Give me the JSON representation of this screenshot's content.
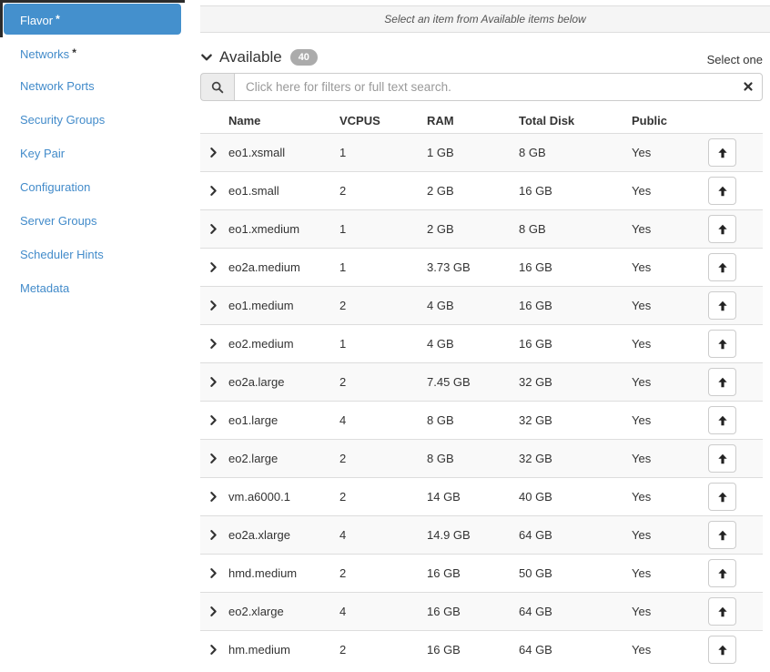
{
  "sidebar": {
    "items": [
      {
        "label": "Flavor",
        "required": true,
        "active": true
      },
      {
        "label": "Networks",
        "required": true,
        "active": false
      },
      {
        "label": "Network Ports",
        "required": false,
        "active": false
      },
      {
        "label": "Security Groups",
        "required": false,
        "active": false
      },
      {
        "label": "Key Pair",
        "required": false,
        "active": false
      },
      {
        "label": "Configuration",
        "required": false,
        "active": false
      },
      {
        "label": "Server Groups",
        "required": false,
        "active": false
      },
      {
        "label": "Scheduler Hints",
        "required": false,
        "active": false
      },
      {
        "label": "Metadata",
        "required": false,
        "active": false
      }
    ]
  },
  "allocated": {
    "empty_message": "Select an item from Available items below"
  },
  "available": {
    "title": "Available",
    "count": "40",
    "select_hint": "Select one",
    "search_placeholder": "Click here for filters or full text search.",
    "columns": [
      "Name",
      "VCPUS",
      "RAM",
      "Total Disk",
      "Public"
    ],
    "rows": [
      {
        "name": "eo1.xsmall",
        "vcpus": "1",
        "ram": "1 GB",
        "disk": "8 GB",
        "public": "Yes"
      },
      {
        "name": "eo1.small",
        "vcpus": "2",
        "ram": "2 GB",
        "disk": "16 GB",
        "public": "Yes"
      },
      {
        "name": "eo1.xmedium",
        "vcpus": "1",
        "ram": "2 GB",
        "disk": "8 GB",
        "public": "Yes"
      },
      {
        "name": "eo2a.medium",
        "vcpus": "1",
        "ram": "3.73 GB",
        "disk": "16 GB",
        "public": "Yes"
      },
      {
        "name": "eo1.medium",
        "vcpus": "2",
        "ram": "4 GB",
        "disk": "16 GB",
        "public": "Yes"
      },
      {
        "name": "eo2.medium",
        "vcpus": "1",
        "ram": "4 GB",
        "disk": "16 GB",
        "public": "Yes"
      },
      {
        "name": "eo2a.large",
        "vcpus": "2",
        "ram": "7.45 GB",
        "disk": "32 GB",
        "public": "Yes"
      },
      {
        "name": "eo1.large",
        "vcpus": "4",
        "ram": "8 GB",
        "disk": "32 GB",
        "public": "Yes"
      },
      {
        "name": "eo2.large",
        "vcpus": "2",
        "ram": "8 GB",
        "disk": "32 GB",
        "public": "Yes"
      },
      {
        "name": "vm.a6000.1",
        "vcpus": "2",
        "ram": "14 GB",
        "disk": "40 GB",
        "public": "Yes"
      },
      {
        "name": "eo2a.xlarge",
        "vcpus": "4",
        "ram": "14.9 GB",
        "disk": "64 GB",
        "public": "Yes"
      },
      {
        "name": "hmd.medium",
        "vcpus": "2",
        "ram": "16 GB",
        "disk": "50 GB",
        "public": "Yes"
      },
      {
        "name": "eo2.xlarge",
        "vcpus": "4",
        "ram": "16 GB",
        "disk": "64 GB",
        "public": "Yes"
      },
      {
        "name": "hm.medium",
        "vcpus": "2",
        "ram": "16 GB",
        "disk": "64 GB",
        "public": "Yes"
      }
    ]
  },
  "icons": {
    "collapse_section": "chevron-down-icon",
    "expand_row": "chevron-right-icon",
    "search": "search-icon",
    "clear_search": "x-icon",
    "allocate": "arrow-up-icon"
  },
  "colors": {
    "accent_blue": "#428bca",
    "active_item_bg": "#4490cd",
    "dark_text": "#333333",
    "panel_bg": "#f5f5f5",
    "stripe_bg": "#f9f9f9",
    "border": "#dddddd",
    "badge_bg": "#ababab",
    "edge_dark": "#2b2b2b"
  }
}
